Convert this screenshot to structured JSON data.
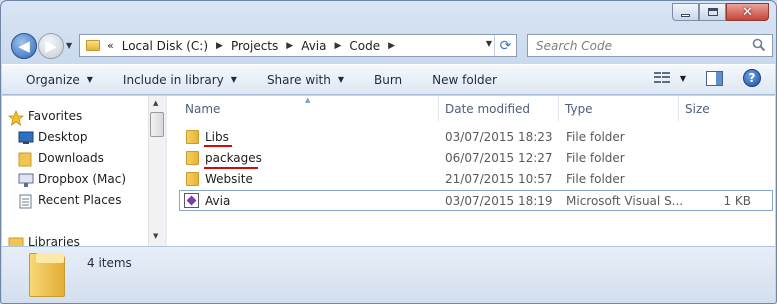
{
  "window": {
    "address_path": [
      "Local Disk (C:)",
      "Projects",
      "Avia",
      "Code"
    ],
    "search_placeholder": "Search Code"
  },
  "toolbar": {
    "organize": "Organize",
    "include_in_library": "Include in library",
    "share_with": "Share with",
    "burn": "Burn",
    "new_folder": "New folder"
  },
  "nav_pane": {
    "favorites": "Favorites",
    "items": [
      "Desktop",
      "Downloads",
      "Dropbox (Mac)",
      "Recent Places"
    ],
    "libraries": "Libraries"
  },
  "columns": {
    "name": "Name",
    "date_modified": "Date modified",
    "type": "Type",
    "size": "Size"
  },
  "files": [
    {
      "name": "Libs",
      "date": "03/07/2015 18:23",
      "type": "File folder",
      "size": "",
      "icon": "folder-icon",
      "underlined": true
    },
    {
      "name": "packages",
      "date": "06/07/2015 12:27",
      "type": "File folder",
      "size": "",
      "icon": "folder-icon",
      "underlined": true
    },
    {
      "name": "Website",
      "date": "21/07/2015 10:57",
      "type": "File folder",
      "size": "",
      "icon": "folder-icon",
      "underlined": false
    },
    {
      "name": "Avia",
      "date": "03/07/2015 18:19",
      "type": "Microsoft Visual S...",
      "size": "1 KB",
      "icon": "visual-studio-solution-icon",
      "underlined": false
    }
  ],
  "details": {
    "item_count": "4 items"
  },
  "colors": {
    "underline": "#d20a0a",
    "selection_border": "#8ba6cc"
  }
}
